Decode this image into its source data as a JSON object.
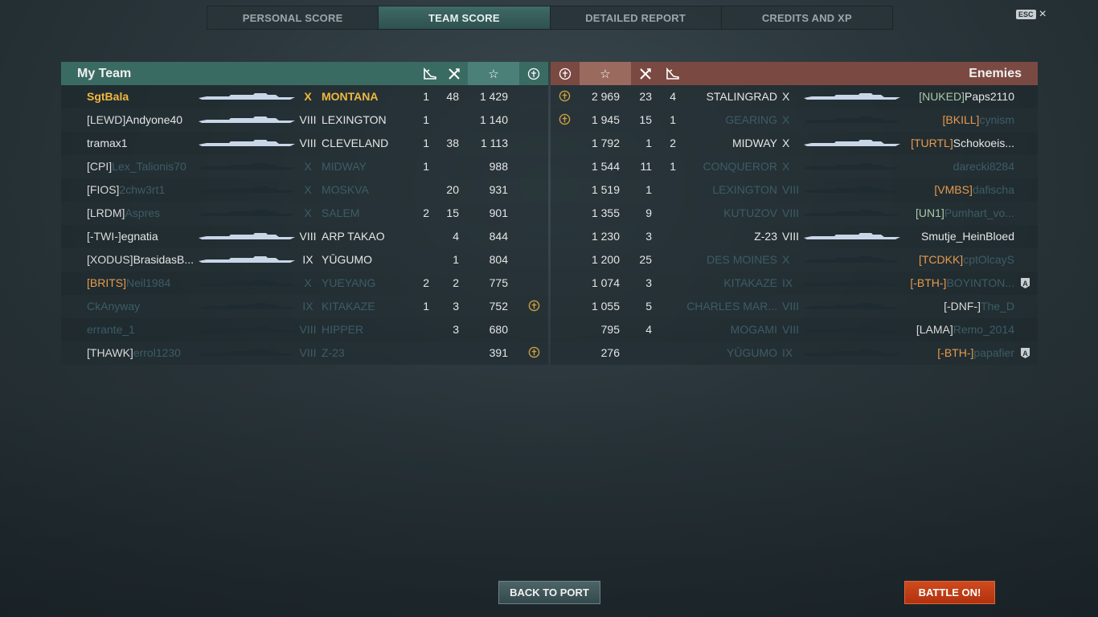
{
  "tabs": [
    {
      "label": "PERSONAL SCORE"
    },
    {
      "label": "TEAM SCORE"
    },
    {
      "label": "DETAILED REPORT"
    },
    {
      "label": "CREDITS AND XP"
    }
  ],
  "esc": {
    "key": "ESC",
    "close": "×"
  },
  "left": {
    "title": "My Team",
    "header_icons": [
      "ribbon-icon",
      "kills-icon",
      "star-icon",
      "medal-icon"
    ],
    "rows": [
      {
        "clan": "",
        "player": "SgtBala",
        "tier": "X",
        "ship": "MONTANA",
        "c1": "1",
        "c2": "48",
        "xp": "1 429",
        "medal": false,
        "style": "me"
      },
      {
        "clan": "[LEWD]",
        "player": "Andyone40",
        "tier": "VIII",
        "ship": "LEXINGTON",
        "c1": "1",
        "c2": "",
        "xp": "1 140",
        "medal": false,
        "style": "alive"
      },
      {
        "clan": "",
        "player": "tramax1",
        "tier": "VIII",
        "ship": "CLEVELAND",
        "c1": "1",
        "c2": "38",
        "xp": "1 113",
        "medal": false,
        "style": "alive"
      },
      {
        "clan": "[CPI]",
        "player": "Lex_Talionis70",
        "tier": "X",
        "ship": "MIDWAY",
        "c1": "1",
        "c2": "",
        "xp": "988",
        "medal": false,
        "style": "dead"
      },
      {
        "clan": "[FIOS]",
        "player": "2chw3rt1",
        "tier": "X",
        "ship": "MOSKVA",
        "c1": "",
        "c2": "20",
        "xp": "931",
        "medal": false,
        "style": "dead"
      },
      {
        "clan": "[LRDM]",
        "player": "Aspres",
        "tier": "X",
        "ship": "SALEM",
        "c1": "2",
        "c2": "15",
        "xp": "901",
        "medal": false,
        "style": "dead"
      },
      {
        "clan": "[-TWI-]",
        "player": "egnatia",
        "tier": "VIII",
        "ship": "ARP TAKAO",
        "c1": "",
        "c2": "4",
        "xp": "844",
        "medal": false,
        "style": "alive"
      },
      {
        "clan": "[XODUS]",
        "player": "BrasidasB...",
        "tier": "IX",
        "ship": "YŪGUMO",
        "c1": "",
        "c2": "1",
        "xp": "804",
        "medal": false,
        "style": "alive"
      },
      {
        "clan": "[BRITS]",
        "player": "Neil1984",
        "tier": "X",
        "ship": "YUEYANG",
        "c1": "2",
        "c2": "2",
        "xp": "775",
        "medal": false,
        "style": "dead"
      },
      {
        "clan": "",
        "player": "CkAnyway",
        "tier": "IX",
        "ship": "KITAKAZE",
        "c1": "1",
        "c2": "3",
        "xp": "752",
        "medal": true,
        "style": "dead"
      },
      {
        "clan": "",
        "player": "errante_1",
        "tier": "VIII",
        "ship": "HIPPER",
        "c1": "",
        "c2": "3",
        "xp": "680",
        "medal": false,
        "style": "dead"
      },
      {
        "clan": "[THAWK]",
        "player": "errol1230",
        "tier": "VIII",
        "ship": "Z-23",
        "c1": "",
        "c2": "",
        "xp": "391",
        "medal": true,
        "style": "dead"
      }
    ]
  },
  "right": {
    "title": "Enemies",
    "header_icons": [
      "medal-icon",
      "star-icon",
      "kills-icon",
      "ribbon-icon"
    ],
    "rows": [
      {
        "medal": true,
        "xp": "2 969",
        "c2": "23",
        "c1": "4",
        "ship": "STALINGRAD",
        "tier": "X",
        "clan": "[NUKED]",
        "player": "Paps2110",
        "badge": "",
        "style": "alive"
      },
      {
        "medal": true,
        "xp": "1 945",
        "c2": "15",
        "c1": "1",
        "ship": "GEARING",
        "tier": "X",
        "clan": "[BKILL]",
        "player": "cynism",
        "badge": "",
        "style": "dead"
      },
      {
        "medal": false,
        "xp": "1 792",
        "c2": "1",
        "c1": "2",
        "ship": "MIDWAY",
        "tier": "X",
        "clan": "[TURTL]",
        "player": "Schokoeis...",
        "badge": "",
        "style": "alive"
      },
      {
        "medal": false,
        "xp": "1 544",
        "c2": "11",
        "c1": "1",
        "ship": "CONQUEROR",
        "tier": "X",
        "clan": "",
        "player": "darecki8284",
        "badge": "",
        "style": "dead"
      },
      {
        "medal": false,
        "xp": "1 519",
        "c2": "1",
        "c1": "",
        "ship": "LEXINGTON",
        "tier": "VIII",
        "clan": "[VMBS]",
        "player": "dafischa",
        "badge": "",
        "style": "dead"
      },
      {
        "medal": false,
        "xp": "1 355",
        "c2": "9",
        "c1": "",
        "ship": "KUTUZOV",
        "tier": "VIII",
        "clan": "[UN1]",
        "player": "Pumhart_vo...",
        "badge": "",
        "style": "dead"
      },
      {
        "medal": false,
        "xp": "1 230",
        "c2": "3",
        "c1": "",
        "ship": "Z-23",
        "tier": "VIII",
        "clan": "",
        "player": "Smutje_HeinBloed",
        "badge": "",
        "style": "alive"
      },
      {
        "medal": false,
        "xp": "1 200",
        "c2": "25",
        "c1": "",
        "ship": "DES MOINES",
        "tier": "X",
        "clan": "[TCDKK]",
        "player": "cptOlcayS",
        "badge": "",
        "style": "dead"
      },
      {
        "medal": false,
        "xp": "1 074",
        "c2": "3",
        "c1": "",
        "ship": "KITAKAZE",
        "tier": "IX",
        "clan": "[-BTH-]",
        "player": "BOYINTON...",
        "badge": "A",
        "style": "dead"
      },
      {
        "medal": false,
        "xp": "1 055",
        "c2": "5",
        "c1": "",
        "ship": "CHARLES MAR...",
        "tier": "VIII",
        "clan": "[-DNF-]",
        "player": "The_D",
        "badge": "",
        "style": "dead"
      },
      {
        "medal": false,
        "xp": "795",
        "c2": "4",
        "c1": "",
        "ship": "MOGAMI",
        "tier": "VIII",
        "clan": "[LAMA]",
        "player": "Remo_2014",
        "badge": "",
        "style": "dead"
      },
      {
        "medal": false,
        "xp": "276",
        "c2": "",
        "c1": "",
        "ship": "YŪGUMO",
        "tier": "IX",
        "clan": "[-BTH-]",
        "player": "papafier",
        "badge": "A",
        "style": "dead"
      }
    ]
  },
  "buttons": {
    "back": "BACK TO PORT",
    "battle": "BATTLE ON!"
  },
  "colors": {
    "my_team": "#3a6b63",
    "enemies": "#7a4a42",
    "highlight": "#f0b840",
    "clan_orange": "#e89a4e",
    "dead_text": "#3d5c66",
    "battle_button": "#c23c14"
  }
}
